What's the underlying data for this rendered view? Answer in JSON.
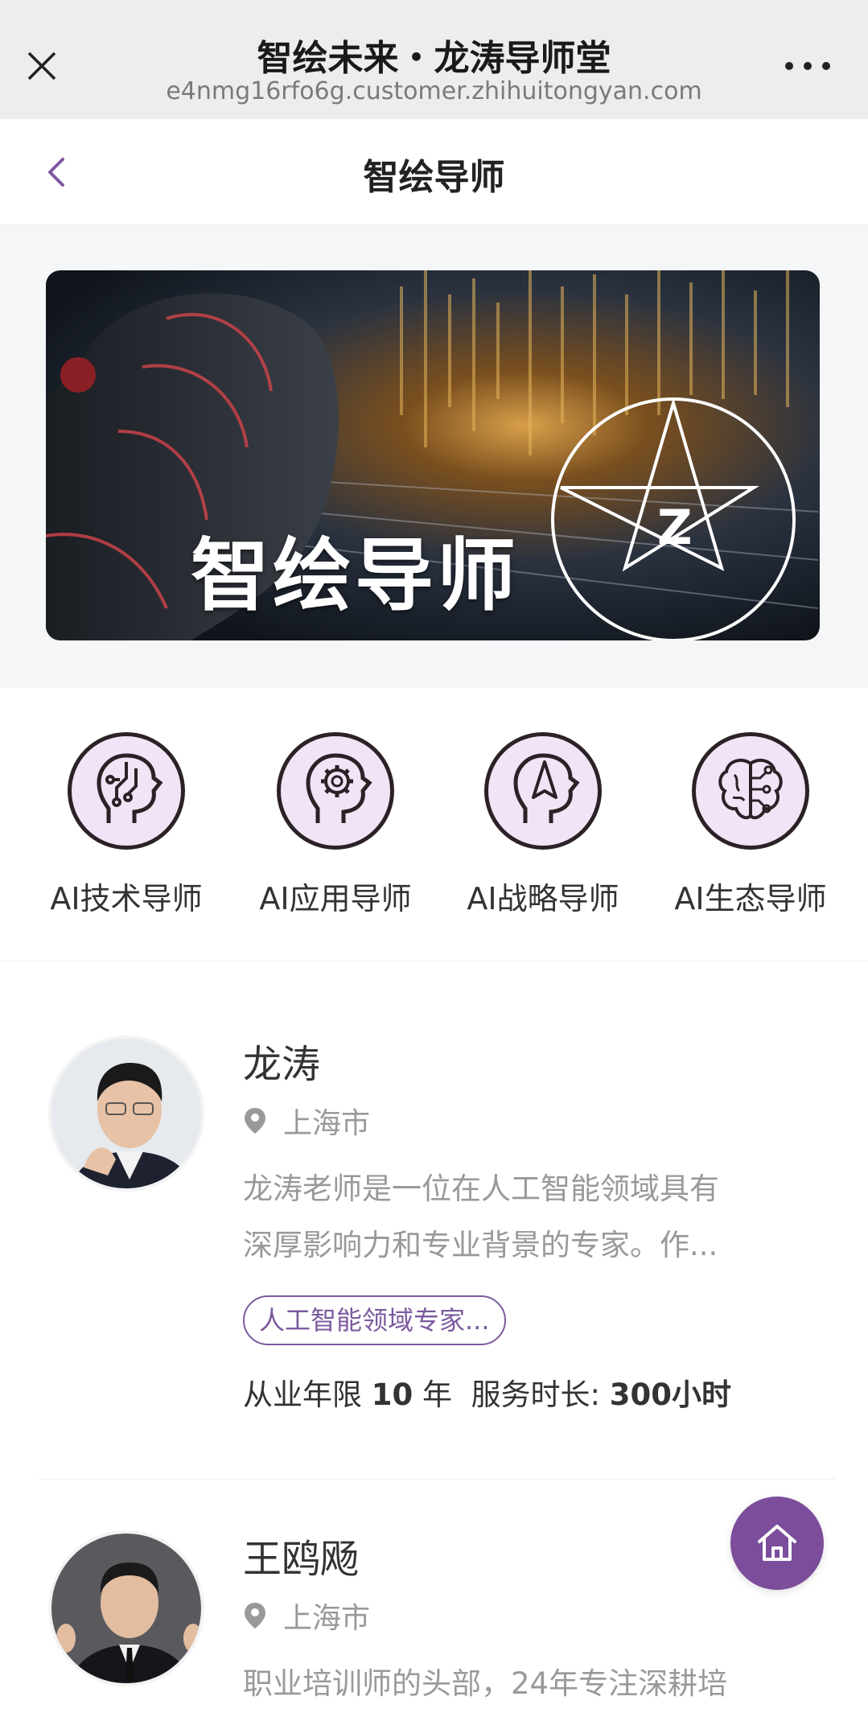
{
  "browser": {
    "title": "智绘未来・龙涛导师堂",
    "url": "e4nmg16rfo6g.customer.zhihuitongyan.com"
  },
  "header": {
    "title": "智绘导师"
  },
  "banner": {
    "text": "智绘导师"
  },
  "categories": [
    {
      "label": "AI技术导师",
      "icon": "circuit-head-icon"
    },
    {
      "label": "AI应用导师",
      "icon": "gear-head-icon"
    },
    {
      "label": "AI战略导师",
      "icon": "compass-head-icon"
    },
    {
      "label": "AI生态导师",
      "icon": "brain-network-icon"
    }
  ],
  "mentors": [
    {
      "name": "龙涛",
      "location": "上海市",
      "desc_line1": "龙涛老师是一位在人工智能领域具有",
      "desc_line2": "深厚影响力和专业背景的专家。作...",
      "tag": "人工智能领域专家...",
      "years_label": "从业年限",
      "years_value": "10",
      "years_unit": "年",
      "service_label": "服务时长:",
      "service_value": "300小时"
    },
    {
      "name": "王鸥飏",
      "location": "上海市",
      "desc_line1": "职业培训师的头部，24年专注深耕培"
    }
  ],
  "colors": {
    "accent": "#7b4d9a",
    "icon_bg": "#f0e4f7"
  }
}
